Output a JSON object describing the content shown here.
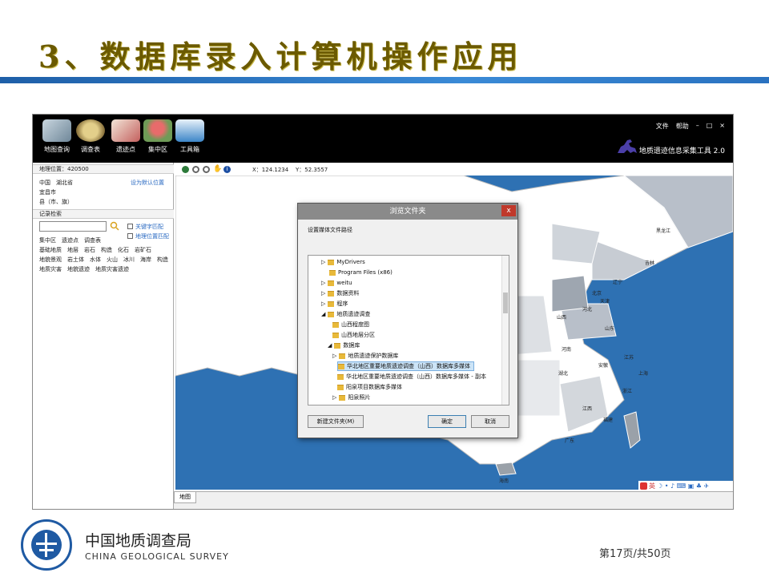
{
  "slide": {
    "title": "3、数据库录入计算机操作应用",
    "page": "第17页/共50页"
  },
  "app": {
    "name": "地质遗迹信息采集工具 2.0",
    "menu": [
      "文件",
      "帮助",
      "–",
      "□",
      "×"
    ],
    "tools": [
      {
        "label": "地图查询",
        "icon": "map-query-icon",
        "color": "#8fa4b5"
      },
      {
        "label": "调查表",
        "icon": "survey-table-icon",
        "color": "#b89a5c"
      },
      {
        "label": "遗迹点",
        "icon": "site-point-icon",
        "color": "#c07a7a"
      },
      {
        "label": "集中区",
        "icon": "cluster-area-icon",
        "color": "#b04848"
      },
      {
        "label": "工具箱",
        "icon": "toolbox-icon",
        "color": "#3d86c8"
      }
    ]
  },
  "left": {
    "location_label": "地理位置：420500",
    "location_lines": [
      "中国　湖北省",
      "宜昌市",
      "县（市、旗）"
    ],
    "set_default": "设为默认位置",
    "records_title": "记录检索",
    "search_value": "",
    "check_keyword": "关键字匹配",
    "check_geo": "地理位置匹配",
    "cat_lines": [
      "集中区　遗迹点　调查表",
      "基础地质　地层　岩石　构造　化石　岩矿石",
      "地貌景观　岩土体　水体　火山　冰川　海岸　构造",
      "地质灾害　地貌遗迹　地质灾害遗迹"
    ]
  },
  "map": {
    "coord_x": "X：124.1234",
    "coord_y": "Y：52.3557",
    "tab": "地图",
    "ocean_color": "#2e71b3",
    "land_color": "#ffffff",
    "provinces": [
      "黑龙江",
      "吉林",
      "辽宁",
      "北京",
      "天津",
      "河北",
      "山西",
      "山东",
      "河南",
      "江苏",
      "上海",
      "安徽",
      "湖北",
      "浙江",
      "江西",
      "福建",
      "广东",
      "海南"
    ],
    "ime_label": "英"
  },
  "dialog": {
    "title": "浏览文件夹",
    "close": "x",
    "prompt": "设置媒体文件路径",
    "tree": [
      {
        "label": "MyDrivers",
        "arrow": "▷"
      },
      {
        "label": "Program Files (x86)",
        "arrow": ""
      },
      {
        "label": "weitu",
        "arrow": "▷"
      },
      {
        "label": "数据资料",
        "arrow": "▷"
      },
      {
        "label": "程序",
        "arrow": "▷"
      },
      {
        "label": "地质遗迹调查",
        "arrow": "◢"
      },
      {
        "label": "山西程度图",
        "arrow": ""
      },
      {
        "label": "山西地层分区",
        "arrow": ""
      },
      {
        "label": "数据库",
        "arrow": "◢"
      },
      {
        "label": "地质遗迹保护数据库",
        "arrow": "▷"
      },
      {
        "label": "华北地区重要地质遗迹调查（山西）数据库多媒体",
        "arrow": "",
        "selected": true
      },
      {
        "label": "华北地区重要地质遗迹调查（山西）数据库多媒体 - 副本",
        "arrow": ""
      },
      {
        "label": "阳泉项目数据库多媒体",
        "arrow": ""
      },
      {
        "label": "阳泉照片",
        "arrow": "▷"
      },
      {
        "label": "…",
        "arrow": ""
      }
    ],
    "new_folder": "新建文件夹(M)",
    "ok": "确定",
    "cancel": "取消"
  },
  "org": {
    "cn": "中国地质调查局",
    "en": "CHINA GEOLOGICAL SURVEY"
  }
}
